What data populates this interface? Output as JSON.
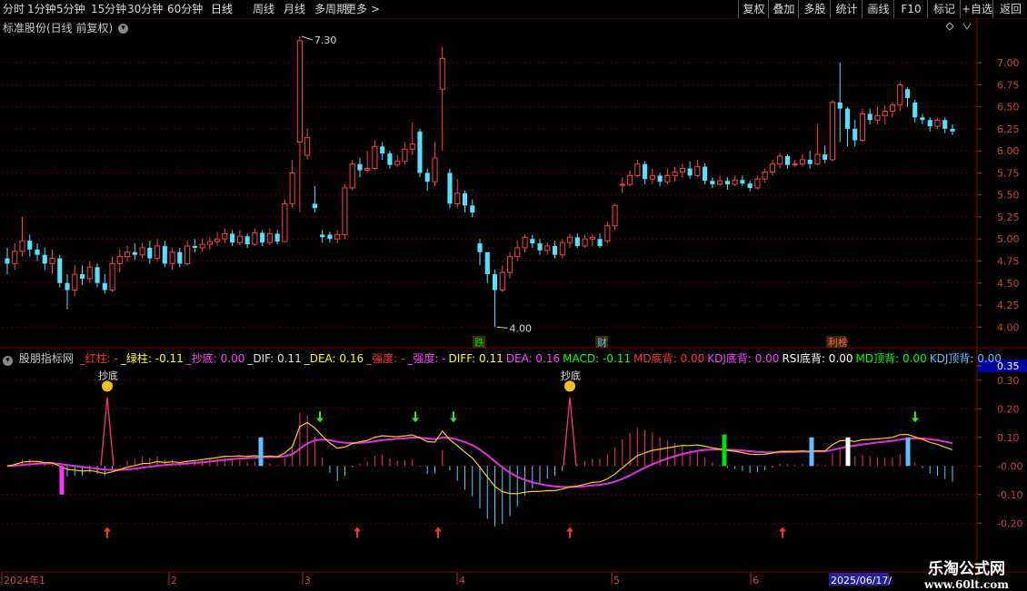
{
  "toolbar": {
    "periods": [
      "分时",
      "1分钟",
      "5分钟",
      "15分钟",
      "30分钟",
      "60分钟",
      "日线",
      "周线",
      "月线",
      "多周期",
      "更多 >"
    ],
    "active_period": "日线",
    "right_buttons": [
      "复权",
      "叠加",
      "多股",
      "统计",
      "画线",
      "F10",
      "标记",
      "+自选",
      "返回"
    ]
  },
  "main_chart": {
    "title": "标准股份(日线 前复权)",
    "price_ticks": [
      "7.00",
      "6.75",
      "6.50",
      "6.25",
      "6.00",
      "5.75",
      "5.50",
      "5.25",
      "5.00",
      "4.75",
      "4.50",
      "4.25",
      "4.00"
    ],
    "high_label": "7.30",
    "low_label": "4.00",
    "markers": [
      {
        "text": "跌",
        "color": "#00d000"
      },
      {
        "text": "财",
        "color": "#60c0ff"
      },
      {
        "text": "利榜",
        "color": "#ff6060"
      }
    ]
  },
  "indicator": {
    "name": "股朋指标网",
    "values": [
      {
        "text": "_红柱: -",
        "color": "#ff3030"
      },
      {
        "text": "_绿柱: -0.11",
        "color": "#ffff00"
      },
      {
        "text": "_抄底: 0.00",
        "color": "#ff40ff"
      },
      {
        "text": "_DIF: 0.11",
        "color": "#e0e0e0"
      },
      {
        "text": "_DEA: 0.16",
        "color": "#ffff00"
      },
      {
        "text": "_强度: -",
        "color": "#ff3030"
      },
      {
        "text": "_强度: -",
        "color": "#ff40ff"
      },
      {
        "text": "DIFF: 0.11",
        "color": "#ffff00"
      },
      {
        "text": "DEA: 0.16",
        "color": "#ff40ff"
      },
      {
        "text": "MACD: -0.11",
        "color": "#00ff00"
      },
      {
        "text": "MD底背: 0.00",
        "color": "#ff3030"
      },
      {
        "text": "KDJ底背: 0.00",
        "color": "#ff40ff"
      },
      {
        "text": "RSI底背: 0.00",
        "color": "#ffffff"
      },
      {
        "text": "MD顶背: 0.00",
        "color": "#00ff00"
      },
      {
        "text": "KDJ顶背: 0.00",
        "color": "#60c0ff"
      }
    ],
    "ticks": [
      "0.35",
      "0.30",
      "0.20",
      "0.10",
      "-0.00",
      "-0.10",
      "-0.20"
    ],
    "labels": [
      "抄底",
      "抄底"
    ]
  },
  "date_axis": {
    "labels": [
      "2024年1",
      "2",
      "3",
      "4",
      "5",
      "6"
    ],
    "current": "2025/06/17/"
  },
  "watermark": {
    "line1": "乐淘公式网",
    "line2": "www.60lt.com"
  },
  "chart_data": {
    "type": "candlestick",
    "ylim": [
      3.9,
      7.3
    ],
    "indicator_ylim": [
      -0.25,
      0.35
    ],
    "candles": [
      [
        4.78,
        4.72,
        4.9,
        4.6
      ],
      [
        4.72,
        4.86,
        4.95,
        4.65
      ],
      [
        4.86,
        4.98,
        5.25,
        4.8
      ],
      [
        4.98,
        4.88,
        5.05,
        4.8
      ],
      [
        4.88,
        4.82,
        4.95,
        4.75
      ],
      [
        4.82,
        4.72,
        4.9,
        4.65
      ],
      [
        4.72,
        4.78,
        4.88,
        4.6
      ],
      [
        4.78,
        4.5,
        4.82,
        4.45
      ],
      [
        4.5,
        4.42,
        4.6,
        4.2
      ],
      [
        4.42,
        4.6,
        4.7,
        4.35
      ],
      [
        4.6,
        4.55,
        4.7,
        4.48
      ],
      [
        4.55,
        4.68,
        4.75,
        4.5
      ],
      [
        4.68,
        4.5,
        4.72,
        4.45
      ],
      [
        4.5,
        4.42,
        4.6,
        4.38
      ],
      [
        4.42,
        4.72,
        4.8,
        4.4
      ],
      [
        4.72,
        4.8,
        4.88,
        4.62
      ],
      [
        4.8,
        4.85,
        4.92,
        4.74
      ],
      [
        4.85,
        4.82,
        4.95,
        4.76
      ],
      [
        4.82,
        4.9,
        4.96,
        4.78
      ],
      [
        4.9,
        4.78,
        4.98,
        4.72
      ],
      [
        4.78,
        4.92,
        5.0,
        4.74
      ],
      [
        4.92,
        4.72,
        4.98,
        4.68
      ],
      [
        4.72,
        4.85,
        4.9,
        4.65
      ],
      [
        4.85,
        4.72,
        4.9,
        4.68
      ],
      [
        4.72,
        4.92,
        4.98,
        4.7
      ],
      [
        4.92,
        4.9,
        5.0,
        4.85
      ],
      [
        4.9,
        4.94,
        5.0,
        4.86
      ],
      [
        4.94,
        4.97,
        5.02,
        4.88
      ],
      [
        4.97,
        5.0,
        5.08,
        4.92
      ],
      [
        5.0,
        5.06,
        5.12,
        4.95
      ],
      [
        5.06,
        4.96,
        5.1,
        4.92
      ],
      [
        4.96,
        5.03,
        5.1,
        4.93
      ],
      [
        5.03,
        4.94,
        5.06,
        4.9
      ],
      [
        4.94,
        5.07,
        5.12,
        4.92
      ],
      [
        5.07,
        4.96,
        5.1,
        4.92
      ],
      [
        4.96,
        5.06,
        5.12,
        4.93
      ],
      [
        5.06,
        4.97,
        5.1,
        4.94
      ],
      [
        4.97,
        5.4,
        5.45,
        4.96
      ],
      [
        5.4,
        5.75,
        5.9,
        5.35
      ],
      [
        6.1,
        7.25,
        7.3,
        5.3
      ],
      [
        5.95,
        6.15,
        6.25,
        5.9
      ],
      [
        5.4,
        5.35,
        5.6,
        5.3
      ],
      [
        5.05,
        5.02,
        5.1,
        4.96
      ],
      [
        5.05,
        5.0,
        5.08,
        4.96
      ],
      [
        5.0,
        5.05,
        5.1,
        4.95
      ],
      [
        5.05,
        5.58,
        5.62,
        5.0
      ],
      [
        5.58,
        5.85,
        5.9,
        5.55
      ],
      [
        5.85,
        5.78,
        5.92,
        5.7
      ],
      [
        5.78,
        5.8,
        6.0,
        5.75
      ],
      [
        5.8,
        6.05,
        6.12,
        5.78
      ],
      [
        6.05,
        5.97,
        6.1,
        5.9
      ],
      [
        5.97,
        5.84,
        6.0,
        5.8
      ],
      [
        5.84,
        5.88,
        5.95,
        5.82
      ],
      [
        5.88,
        6.02,
        6.1,
        5.85
      ],
      [
        6.02,
        6.08,
        6.32,
        5.95
      ],
      [
        6.22,
        5.75,
        6.25,
        5.7
      ],
      [
        5.75,
        5.65,
        5.8,
        5.55
      ],
      [
        5.65,
        5.92,
        6.1,
        5.6
      ],
      [
        6.7,
        7.05,
        7.18,
        6.0
      ],
      [
        5.75,
        5.4,
        5.8,
        5.35
      ],
      [
        5.4,
        5.52,
        5.68,
        5.35
      ],
      [
        5.52,
        5.38,
        5.55,
        5.3
      ],
      [
        5.38,
        5.3,
        5.45,
        5.25
      ],
      [
        4.95,
        4.85,
        5.0,
        4.7
      ],
      [
        4.85,
        4.6,
        4.82,
        4.5
      ],
      [
        4.6,
        4.42,
        4.65,
        4.0
      ],
      [
        4.42,
        4.62,
        4.7,
        4.4
      ],
      [
        4.62,
        4.8,
        4.85,
        4.55
      ],
      [
        4.8,
        4.9,
        4.98,
        4.75
      ],
      [
        4.9,
        5.02,
        5.05,
        4.85
      ],
      [
        5.0,
        4.95,
        5.05,
        4.9
      ],
      [
        4.95,
        4.87,
        5.0,
        4.82
      ],
      [
        4.87,
        4.92,
        4.96,
        4.82
      ],
      [
        4.92,
        4.82,
        4.98,
        4.78
      ],
      [
        4.82,
        4.96,
        5.0,
        4.78
      ],
      [
        4.96,
        5.02,
        5.06,
        4.9
      ],
      [
        5.02,
        4.92,
        5.06,
        4.9
      ],
      [
        4.92,
        5.0,
        5.05,
        4.9
      ],
      [
        5.0,
        5.02,
        5.06,
        4.92
      ],
      [
        5.0,
        4.92,
        5.06,
        4.9
      ],
      [
        4.98,
        5.15,
        5.2,
        4.95
      ],
      [
        5.15,
        5.38,
        5.4,
        5.1
      ],
      [
        5.62,
        5.62,
        5.7,
        5.52
      ],
      [
        5.62,
        5.72,
        5.78,
        5.6
      ],
      [
        5.72,
        5.85,
        5.9,
        5.7
      ],
      [
        5.85,
        5.68,
        5.88,
        5.62
      ],
      [
        5.68,
        5.72,
        5.8,
        5.62
      ],
      [
        5.72,
        5.65,
        5.75,
        5.6
      ],
      [
        5.65,
        5.72,
        5.8,
        5.62
      ],
      [
        5.72,
        5.76,
        5.82,
        5.65
      ],
      [
        5.76,
        5.8,
        5.86,
        5.7
      ],
      [
        5.8,
        5.72,
        5.88,
        5.68
      ],
      [
        5.72,
        5.82,
        5.9,
        5.7
      ],
      [
        5.82,
        5.66,
        5.86,
        5.62
      ],
      [
        5.66,
        5.62,
        5.7,
        5.58
      ],
      [
        5.62,
        5.66,
        5.72,
        5.6
      ],
      [
        5.66,
        5.62,
        5.7,
        5.56
      ],
      [
        5.62,
        5.67,
        5.72,
        5.6
      ],
      [
        5.67,
        5.63,
        5.72,
        5.6
      ],
      [
        5.63,
        5.58,
        5.66,
        5.54
      ],
      [
        5.58,
        5.68,
        5.72,
        5.56
      ],
      [
        5.68,
        5.76,
        5.8,
        5.64
      ],
      [
        5.76,
        5.85,
        5.9,
        5.72
      ],
      [
        5.85,
        5.94,
        5.98,
        5.8
      ],
      [
        5.94,
        5.84,
        5.96,
        5.8
      ],
      [
        5.84,
        5.85,
        5.9,
        5.82
      ],
      [
        5.85,
        5.9,
        5.96,
        5.82
      ],
      [
        5.9,
        5.85,
        6.0,
        5.8
      ],
      [
        5.85,
        5.96,
        6.3,
        5.84
      ],
      [
        5.96,
        5.9,
        6.06,
        5.86
      ],
      [
        5.9,
        6.55,
        6.58,
        5.88
      ],
      [
        6.55,
        6.48,
        7.0,
        6.1
      ],
      [
        6.48,
        6.25,
        6.5,
        6.05
      ],
      [
        6.25,
        6.12,
        6.35,
        6.05
      ],
      [
        6.12,
        6.42,
        6.48,
        6.1
      ],
      [
        6.42,
        6.35,
        6.48,
        6.3
      ],
      [
        6.35,
        6.4,
        6.5,
        6.3
      ],
      [
        6.4,
        6.45,
        6.52,
        6.3
      ],
      [
        6.45,
        6.52,
        6.55,
        6.38
      ],
      [
        6.52,
        6.75,
        6.78,
        6.45
      ],
      [
        6.7,
        6.6,
        6.72,
        6.5
      ],
      [
        6.55,
        6.38,
        6.58,
        6.32
      ],
      [
        6.38,
        6.35,
        6.42,
        6.3
      ],
      [
        6.35,
        6.28,
        6.38,
        6.22
      ],
      [
        6.28,
        6.35,
        6.38,
        6.25
      ],
      [
        6.35,
        6.25,
        6.38,
        6.2
      ],
      [
        6.25,
        6.22,
        6.3,
        6.18
      ]
    ]
  }
}
